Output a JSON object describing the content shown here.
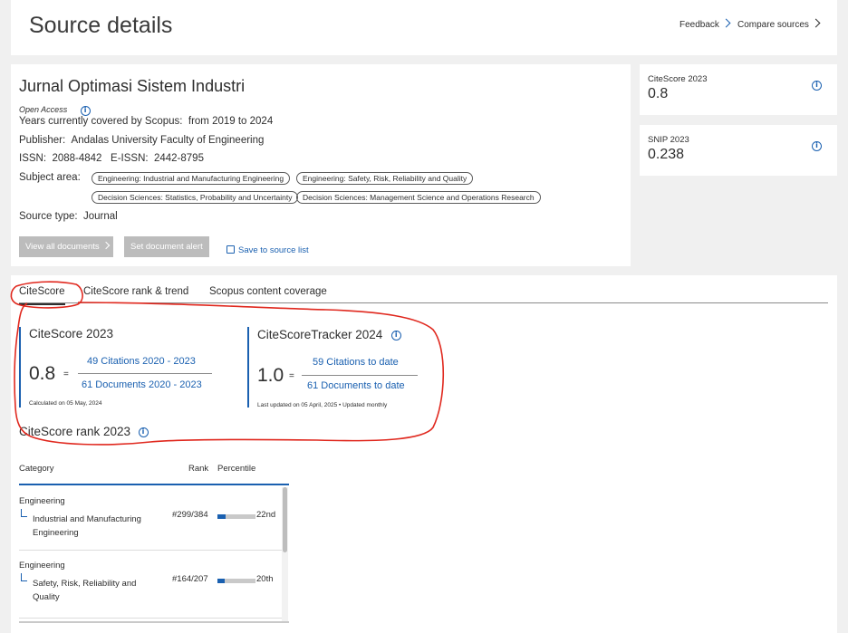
{
  "header": {
    "title": "Source details",
    "feedback_label": "Feedback",
    "compare_label": "Compare sources"
  },
  "source": {
    "title": "Jurnal Optimasi Sistem Industri",
    "open_access": "Open Access",
    "years_label": "Years currently covered by Scopus:",
    "years_value": "from 2019 to 2024",
    "publisher_label": "Publisher:",
    "publisher_value": "Andalas University Faculty of Engineering",
    "issn_label": "ISSN:",
    "issn_value": "2088-4842",
    "eissn_label": "E-ISSN:",
    "eissn_value": "2442-8795",
    "subject_label": "Subject area:",
    "subjects": [
      "Engineering: Industrial and Manufacturing Engineering",
      "Engineering: Safety, Risk, Reliability and Quality",
      "Decision Sciences: Statistics, Probability and Uncertainty",
      "Decision Sciences: Management Science and Operations Research"
    ],
    "type_label": "Source type:",
    "type_value": "Journal",
    "view_all_label": "View all documents",
    "alert_label": "Set document alert",
    "save_label": "Save to source list"
  },
  "metrics": {
    "citescore_label": "CiteScore 2023",
    "citescore_value": "0.8",
    "snip_label": "SNIP 2023",
    "snip_value": "0.238"
  },
  "tabs": [
    {
      "label": "CiteScore",
      "active": true
    },
    {
      "label": "CiteScore rank & trend",
      "active": false
    },
    {
      "label": "Scopus content coverage",
      "active": false
    }
  ],
  "citescore": {
    "title": "CiteScore 2023",
    "value": "0.8",
    "numerator": "49 Citations 2020 - 2023",
    "denominator": "61 Documents 2020 - 2023",
    "calculated": "Calculated on 05 May, 2024"
  },
  "tracker": {
    "title": "CiteScoreTracker 2024",
    "value": "1.0",
    "numerator": "59 Citations to date",
    "denominator": "61 Documents to date",
    "updated": "Last updated on 05 April, 2025 • Updated monthly"
  },
  "rank": {
    "title": "CiteScore rank 2023",
    "col_category": "Category",
    "col_rank": "Rank",
    "col_percentile": "Percentile",
    "rows": [
      {
        "field": "Engineering",
        "sub1": "Industrial and Manufacturing",
        "sub2": "Engineering",
        "rank": "#299/384",
        "percentile_label": "22nd",
        "percentile": 22
      },
      {
        "field": "Engineering",
        "sub1": "Safety, Risk, Reliability and",
        "sub2": "Quality",
        "rank": "#164/207",
        "percentile_label": "20th",
        "percentile": 20
      }
    ]
  },
  "colors": {
    "accent": "#1a60b0",
    "annotation": "#e0281e"
  }
}
